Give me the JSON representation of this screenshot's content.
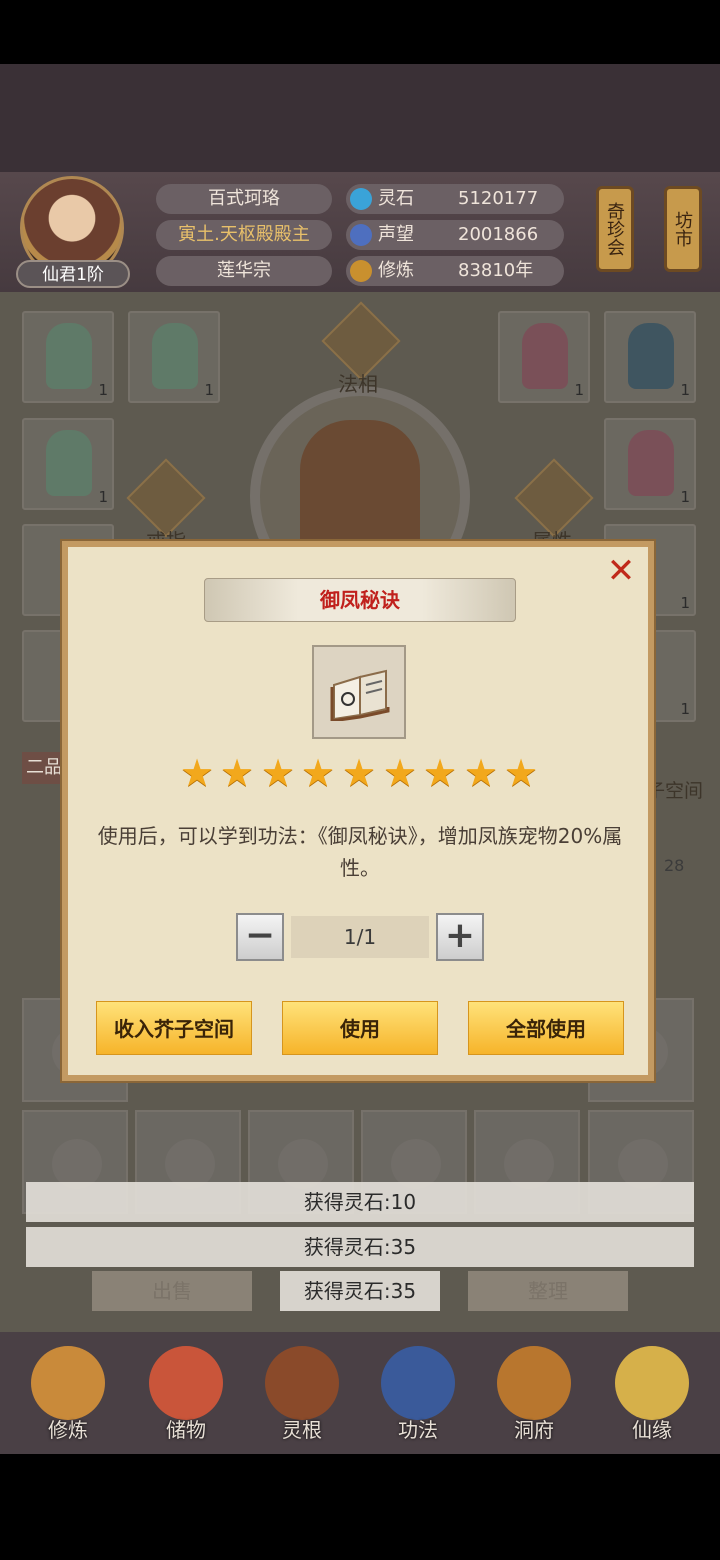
{
  "header": {
    "character_name": "百式珂珞",
    "title": "寅土.天枢殿殿主",
    "sect": "莲华宗",
    "rank": "仙君1阶",
    "stats": [
      {
        "label": "灵石",
        "value": "5120177",
        "icon": "spirit-stone-icon",
        "color": "#3aa3d8"
      },
      {
        "label": "声望",
        "value": "2001866",
        "icon": "prestige-icon",
        "color": "#4e6fbf"
      },
      {
        "label": "修炼",
        "value": "83810年",
        "icon": "cultivation-icon",
        "color": "#c9902e"
      }
    ],
    "side_buttons": [
      "奇珍会",
      "坊市"
    ]
  },
  "background": {
    "center_labels": [
      "法相",
      "戒指",
      "属性"
    ],
    "left_slot_counts": [
      "1",
      "1",
      "1"
    ],
    "right_slot_counts": [
      "1",
      "1",
      "1",
      "1",
      "1"
    ],
    "grade_label": "二品",
    "space_label": "子空间",
    "space_count": "28",
    "sell_button": "出售",
    "sort_button": "整理"
  },
  "dialog": {
    "title": "御凤秘诀",
    "item_icon": "book-icon",
    "stars": 9,
    "description": "使用后，可以学到功法：《御凤秘诀》，增加凤族宠物20%属性。",
    "quantity": "1/1",
    "buttons": {
      "store": "收入芥子空间",
      "use": "使用",
      "use_all": "全部使用"
    }
  },
  "toasts": [
    "获得灵石:10",
    "获得灵石:35",
    "获得灵石:35"
  ],
  "nav": [
    {
      "label": "修炼",
      "icon": "meditation-icon",
      "color": "#c98a3a"
    },
    {
      "label": "储物",
      "icon": "storage-bag-icon",
      "color": "#c9553a"
    },
    {
      "label": "灵根",
      "icon": "spirit-root-icon",
      "color": "#8a4a2a"
    },
    {
      "label": "功法",
      "icon": "technique-book-icon",
      "color": "#3a5a9a"
    },
    {
      "label": "洞府",
      "icon": "cave-dwelling-icon",
      "color": "#b8762e"
    },
    {
      "label": "仙缘",
      "icon": "immortal-fate-icon",
      "color": "#d6b04a"
    }
  ]
}
